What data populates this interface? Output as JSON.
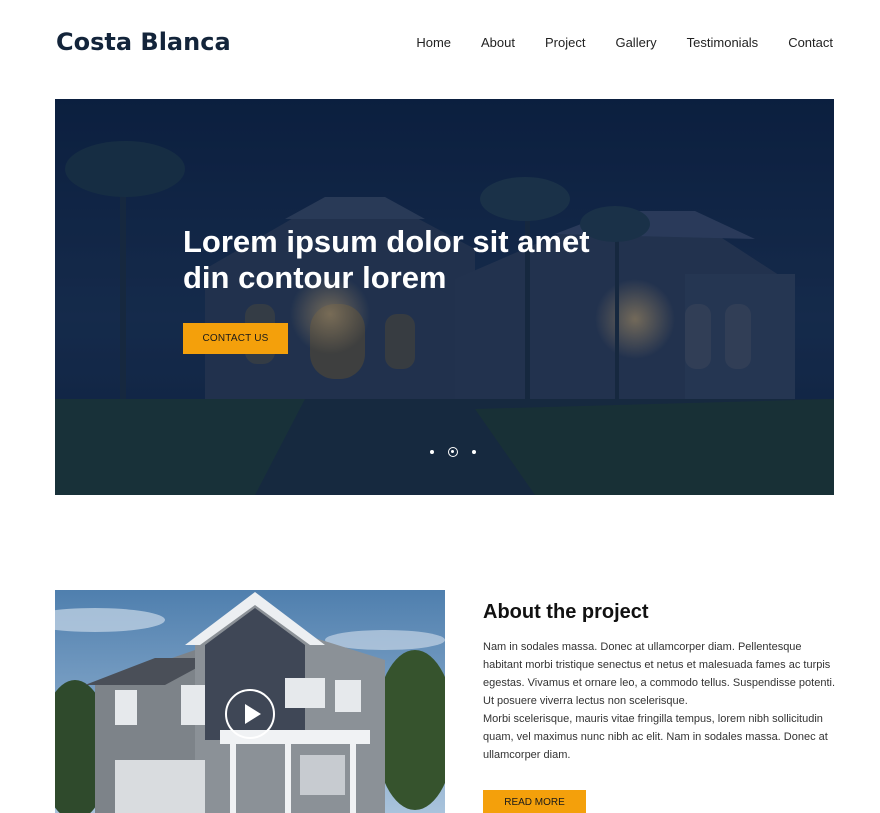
{
  "header": {
    "logo": "Costa Blanca",
    "nav": [
      "Home",
      "About",
      "Project",
      "Gallery",
      "Testimonials",
      "Contact"
    ]
  },
  "hero": {
    "title": "Lorem ipsum dolor sit amet din contour lorem",
    "button_label": "CONTACT US",
    "slide_count": 3,
    "active_slide": 2,
    "overlay_color": "#0b2145"
  },
  "about": {
    "title": "About the project",
    "paragraph1": "Nam in sodales massa. Donec at ullamcorper diam. Pellentesque habitant morbi tristique senectus et netus et malesuada fames ac turpis egestas. Vivamus et ornare leo, a commodo tellus. Suspendisse potenti. Ut posuere viverra lectus non scelerisque.",
    "paragraph2": "Morbi scelerisque, mauris vitae fringilla tempus, lorem nibh sollicitudin quam, vel maximus nunc nibh ac elit. Nam in sodales massa. Donec at ullamcorper diam.",
    "button_label": "READ MORE",
    "media_icon": "play-icon"
  },
  "colors": {
    "accent": "#f4a00b",
    "brand_dark": "#13243a"
  }
}
